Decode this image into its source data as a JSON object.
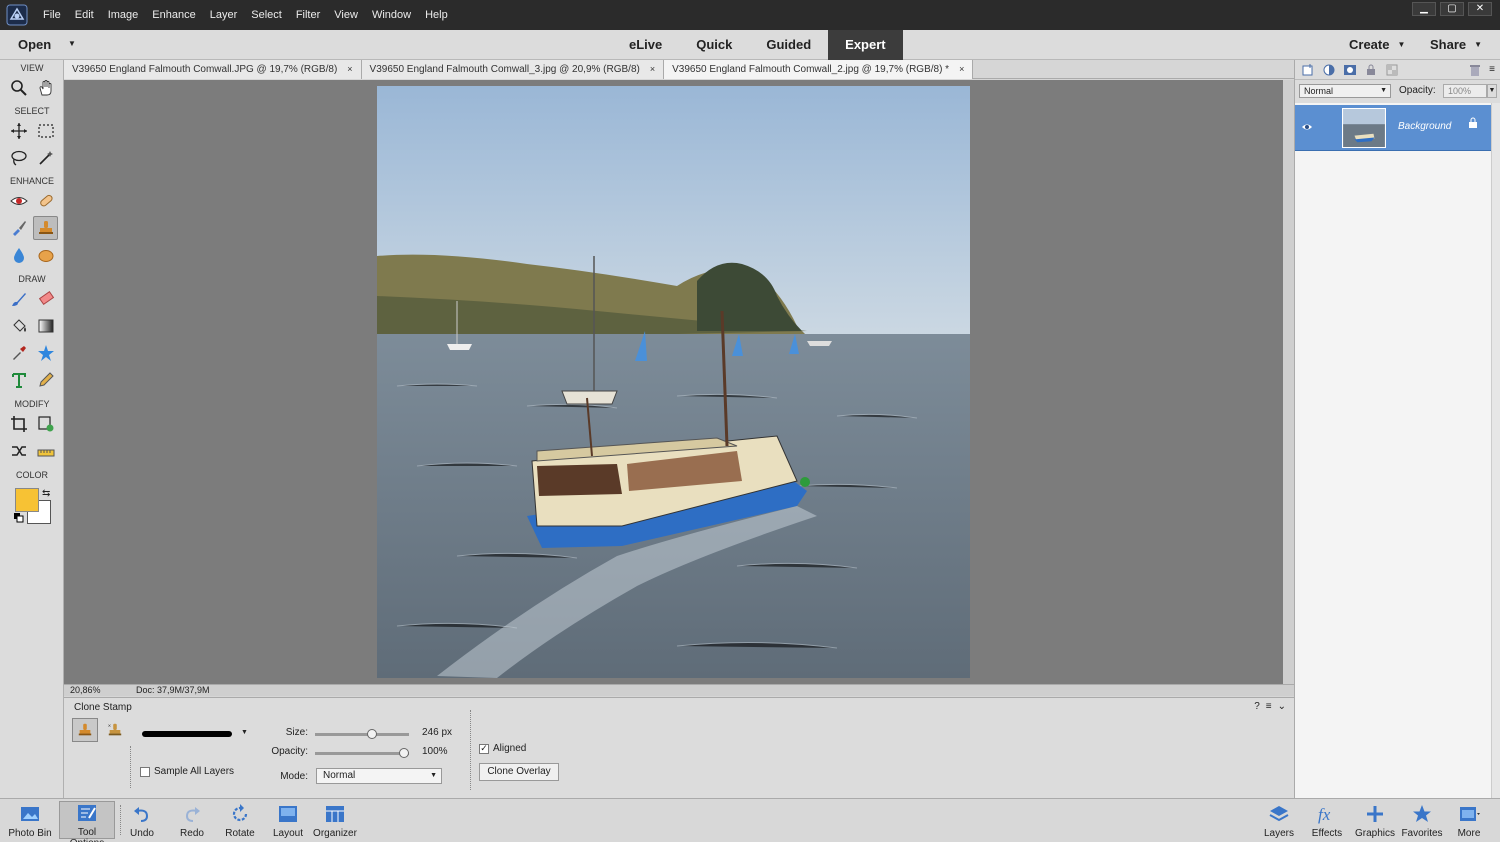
{
  "menu": {
    "items": [
      "File",
      "Edit",
      "Image",
      "Enhance",
      "Layer",
      "Select",
      "Filter",
      "View",
      "Window",
      "Help"
    ]
  },
  "window_buttons": {
    "minimize": "▁",
    "maximize": "▢",
    "close": "✕"
  },
  "modebar": {
    "open_label": "Open",
    "modes": [
      "eLive",
      "Quick",
      "Guided",
      "Expert"
    ],
    "active_mode": "Expert",
    "create_label": "Create",
    "share_label": "Share"
  },
  "toolbox": {
    "sections": {
      "view": "VIEW",
      "select": "SELECT",
      "enhance": "ENHANCE",
      "draw": "DRAW",
      "modify": "MODIFY",
      "color": "COLOR"
    },
    "foreground_color": "#f7c234",
    "background_color": "#ffffff"
  },
  "tabs": [
    {
      "title": "V39650 England Falmouth Comwall.JPG @ 19,7% (RGB/8)",
      "close": "×"
    },
    {
      "title": "V39650 England Falmouth Comwall_3.jpg @ 20,9% (RGB/8)",
      "close": "×"
    },
    {
      "title": "V39650 England Falmouth Comwall_2.jpg @ 19,7% (RGB/8) *",
      "close": "×"
    }
  ],
  "status": {
    "zoom": "20,86%",
    "doc": "Doc: 37,9M/37,9M"
  },
  "tool_options": {
    "title": "Clone Stamp",
    "size_label": "Size:",
    "size_value": "246 px",
    "size_fraction": 0.62,
    "opacity_label": "Opacity:",
    "opacity_value": "100%",
    "opacity_fraction": 1.0,
    "mode_label": "Mode:",
    "mode_value": "Normal",
    "sample_all_layers": "Sample All Layers",
    "aligned": "Aligned",
    "clone_overlay": "Clone Overlay",
    "help": "?"
  },
  "layers_panel": {
    "blend_mode": "Normal",
    "opacity_label": "Opacity:",
    "opacity_value": "100%",
    "layer_name": "Background"
  },
  "bottombar": {
    "left": [
      "Photo Bin",
      "Tool Options",
      "Undo",
      "Redo",
      "Rotate",
      "Layout",
      "Organizer"
    ],
    "right": [
      "Layers",
      "Effects",
      "Graphics",
      "Favorites",
      "More"
    ]
  },
  "colors": {
    "accent_selected_layer": "#5b8fd1",
    "canvas_bg": "#7c7c7c",
    "menubar": "#2b2b2b"
  }
}
